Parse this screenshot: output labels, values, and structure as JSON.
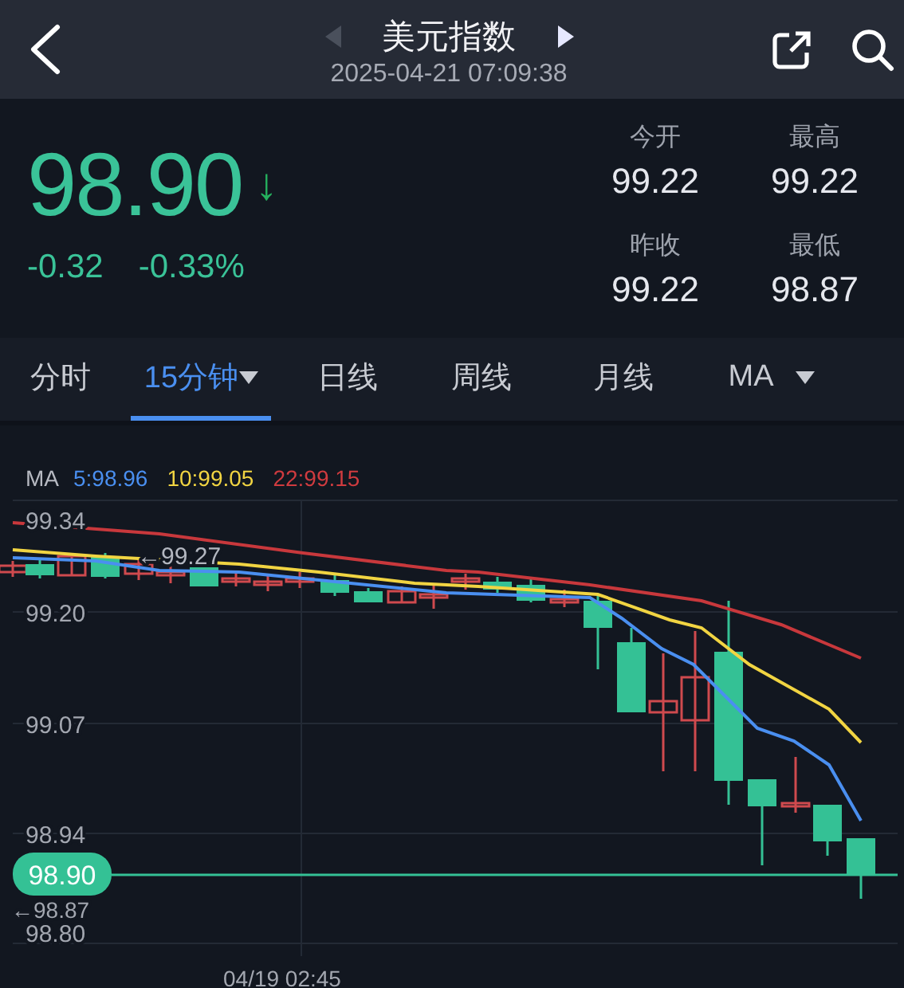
{
  "header": {
    "title": "美元指数",
    "datetime": "2025-04-21 07:09:38",
    "nav": [
      {
        "kind": "prev",
        "disabled": true
      },
      {
        "kind": "next",
        "disabled": false
      }
    ]
  },
  "quote": {
    "price": "98.90",
    "arrow": "↓",
    "change": "-0.32",
    "change_percent": "-0.33%",
    "stats": [
      {
        "label": "今开",
        "value": "99.22"
      },
      {
        "label": "最高",
        "value": "99.22"
      },
      {
        "label": "昨收",
        "value": "99.22"
      },
      {
        "label": "最低",
        "value": "98.87"
      }
    ]
  },
  "tabs": [
    {
      "label": "分时",
      "selected": false,
      "dropdown": false
    },
    {
      "label": "15分钟",
      "selected": true,
      "dropdown": true
    },
    {
      "label": "日线",
      "selected": false,
      "dropdown": false
    },
    {
      "label": "周线",
      "selected": false,
      "dropdown": false
    },
    {
      "label": "月线",
      "selected": false,
      "dropdown": false
    },
    {
      "label": "MA",
      "selected": false,
      "dropdown": true
    }
  ],
  "chart": {
    "legend_title": "MA",
    "legend": [
      {
        "label": "5:98.96",
        "color": "#4a8ff0"
      },
      {
        "label": "10:99.05",
        "color": "#f1d442"
      },
      {
        "label": "22:99.15",
        "color": "#cf3b3f"
      }
    ],
    "y_labels": [
      "99.34",
      "99.20",
      "99.07",
      "98.94",
      "98.80"
    ],
    "high_marker": "←99.27",
    "low_marker": "←98.87",
    "current_price": "98.90",
    "x_label": "04/19 02:45"
  }
}
